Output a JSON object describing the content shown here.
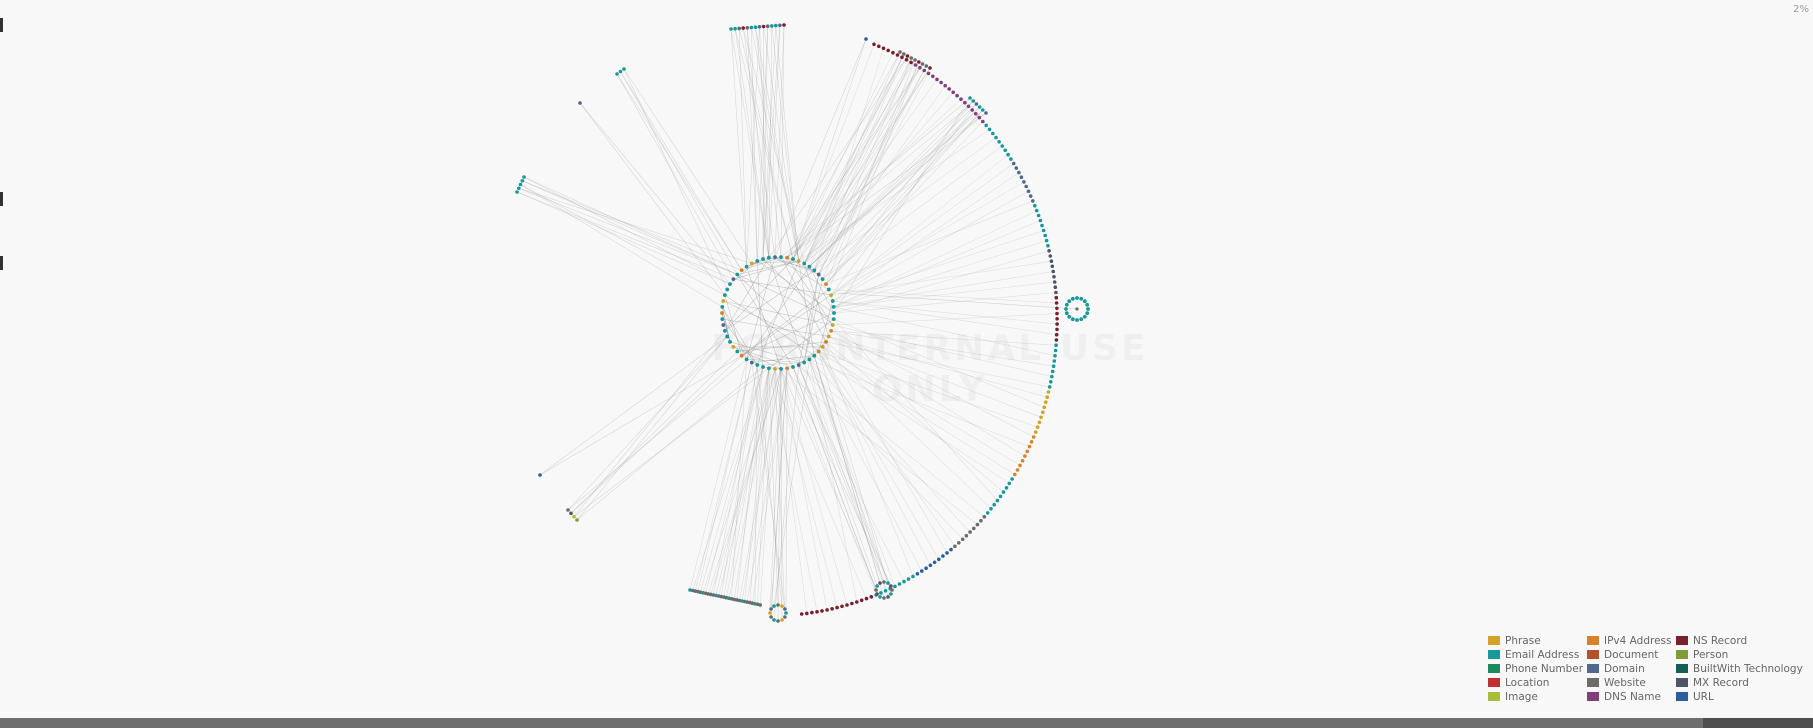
{
  "zoom": {
    "label": "2%"
  },
  "watermark": {
    "text": "FOR INTERNAL USE ONLY"
  },
  "legend": {
    "items": [
      {
        "label": "Phrase",
        "color": "#d4a227"
      },
      {
        "label": "IPv4 Address",
        "color": "#d9822b"
      },
      {
        "label": "NS Record",
        "color": "#7a1f2b"
      },
      {
        "label": "Email Address",
        "color": "#17989b"
      },
      {
        "label": "Document",
        "color": "#b5502a"
      },
      {
        "label": "Person",
        "color": "#7f9c3a"
      },
      {
        "label": "Phone Number",
        "color": "#1c8a5a"
      },
      {
        "label": "Domain",
        "color": "#52688f"
      },
      {
        "label": "BuiltWith Technology",
        "color": "#145e56"
      },
      {
        "label": "Location",
        "color": "#c0302f"
      },
      {
        "label": "Website",
        "color": "#6b6b6b"
      },
      {
        "label": "MX Record",
        "color": "#4e5566"
      },
      {
        "label": "Image",
        "color": "#a8be3a"
      },
      {
        "label": "DNS Name",
        "color": "#7f3f78"
      },
      {
        "label": "URL",
        "color": "#2a5f9e"
      }
    ]
  },
  "graph": {
    "clusters": [
      {
        "name": "top-cluster",
        "types": [
          "Email Address",
          "Domain",
          "Email Address",
          "NS Record"
        ]
      },
      {
        "name": "upper-left-cluster",
        "types": [
          "Email Address"
        ]
      },
      {
        "name": "left-cluster",
        "types": [
          "Email Address"
        ]
      },
      {
        "name": "top-right-cluster",
        "types": [
          "Website",
          "NS Record"
        ]
      },
      {
        "name": "right-cluster",
        "types": [
          "Email Address",
          "Domain"
        ]
      },
      {
        "name": "lower-left-cluster",
        "types": [
          "Website",
          "Image"
        ]
      },
      {
        "name": "big-arc",
        "types": [
          "NS Record",
          "DNS Name",
          "Email Address",
          "Domain",
          "MX Record",
          "Phrase",
          "IPv4 Address",
          "Website",
          "URL"
        ]
      },
      {
        "name": "center-ring",
        "types": [
          "Email Address",
          "Domain",
          "IPv4 Address",
          "Phrase"
        ]
      }
    ]
  }
}
